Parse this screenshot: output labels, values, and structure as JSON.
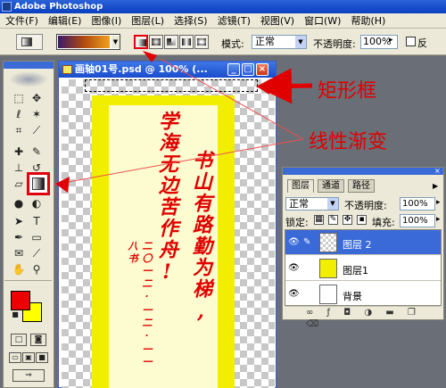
{
  "window": {
    "title": "Adobe Photoshop"
  },
  "menu": [
    "文件(F)",
    "编辑(E)",
    "图像(I)",
    "图层(L)",
    "选择(S)",
    "滤镜(T)",
    "视图(V)",
    "窗口(W)",
    "帮助(H)"
  ],
  "options": {
    "mode_label": "模式:",
    "mode_value": "正常",
    "opacity_label": "不透明度:",
    "opacity_value": "100%",
    "reverse_label": "反",
    "gradient_colors": [
      "#3a1a6a",
      "#b04a10",
      "#f0a020"
    ]
  },
  "colors": {
    "foreground": "#ee0000",
    "background": "#ffff00",
    "accent": "#e00010"
  },
  "document": {
    "title": "画轴01号.psd @ 100% (...",
    "scroll_text_line1": "学海无边苦作舟!",
    "scroll_text_line2": "书山有路勤为梯,",
    "scroll_text_line3": "二〇一二·一二·一一 八书"
  },
  "layers_panel": {
    "tabs": [
      "图层",
      "通道",
      "路径"
    ],
    "blend_mode": "正常",
    "opacity_label": "不透明度:",
    "opacity_value": "100%",
    "lock_label": "锁定:",
    "fill_label": "填充:",
    "fill_value": "100%",
    "layers": [
      {
        "name": "图层 2",
        "selected": true
      },
      {
        "name": "图层1",
        "selected": false
      },
      {
        "name": "背景",
        "selected": false
      }
    ],
    "footer_icons": [
      "link-icon",
      "style-icon",
      "mask-icon",
      "adjustment-icon",
      "folder-icon",
      "new-layer-icon",
      "trash-icon"
    ]
  },
  "annotations": {
    "marquee": "矩形框",
    "gradient": "线性渐变"
  }
}
